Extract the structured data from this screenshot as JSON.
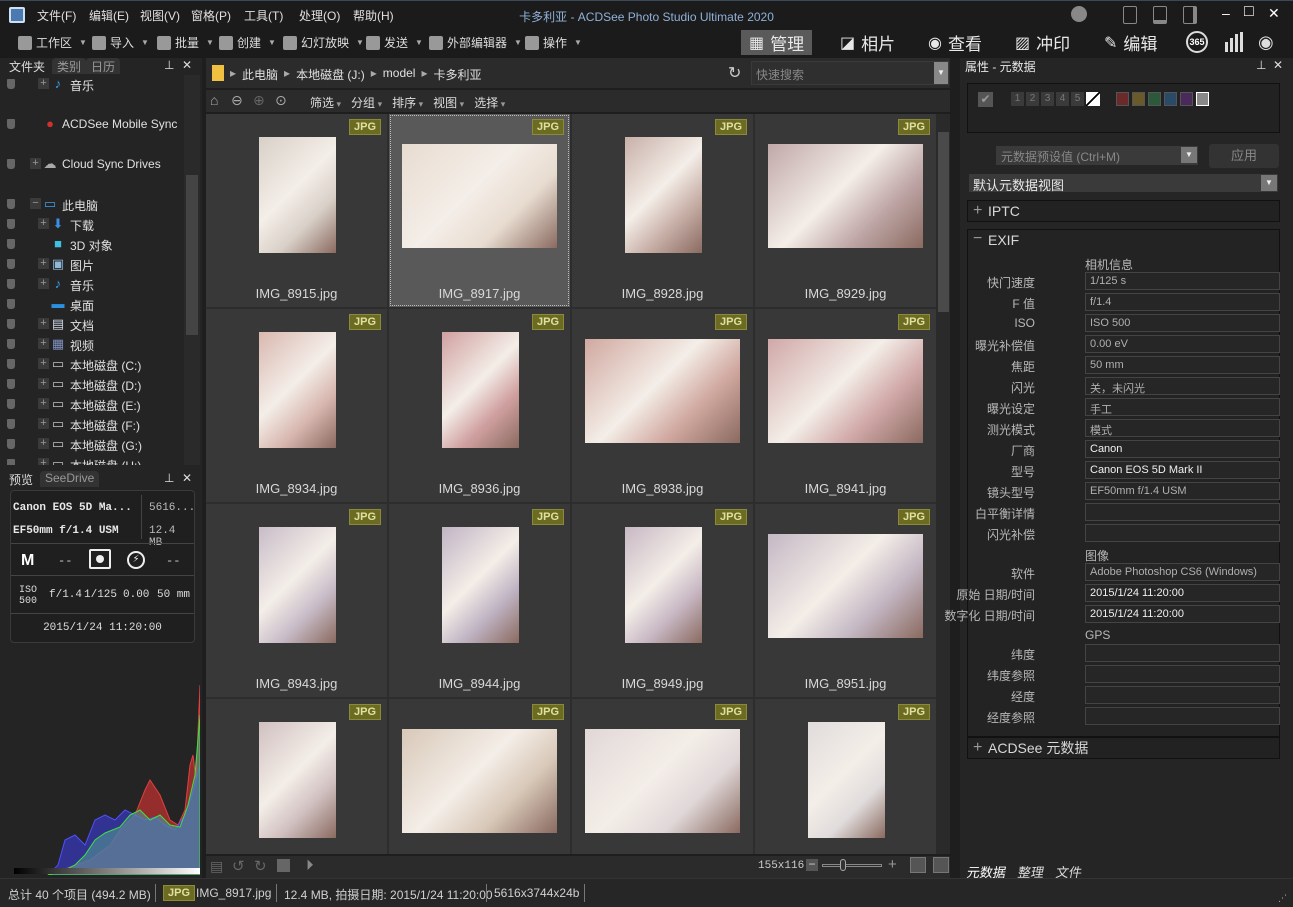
{
  "window": {
    "title": "卡多利亚 - ACDSee Photo Studio Ultimate 2020",
    "controls": {
      "minimize": "‒",
      "maximize": "□",
      "close": "✕"
    }
  },
  "menu": [
    "文件(F)",
    "编辑(E)",
    "视图(V)",
    "窗格(P)",
    "工具(T)",
    "处理(O)",
    "帮助(H)"
  ],
  "toolbar": {
    "items": [
      {
        "label": "工作区",
        "icon": "workspace-icon"
      },
      {
        "label": "导入",
        "icon": "import-icon"
      },
      {
        "label": "批量",
        "icon": "batch-icon"
      },
      {
        "label": "创建",
        "icon": "create-icon"
      },
      {
        "label": "幻灯放映",
        "icon": "slideshow-icon"
      },
      {
        "label": "发送",
        "icon": "send-icon"
      },
      {
        "label": "外部编辑器",
        "icon": "external-editor-icon"
      },
      {
        "label": "操作",
        "icon": "actions-icon"
      }
    ]
  },
  "modes": [
    {
      "label": "管理",
      "active": true
    },
    {
      "label": "相片",
      "active": false
    },
    {
      "label": "查看",
      "active": false
    },
    {
      "label": "冲印",
      "active": false
    },
    {
      "label": "编辑",
      "active": false
    }
  ],
  "mode_extra": {
    "label_365": "365"
  },
  "left_panel": {
    "tabs": [
      "文件夹",
      "类别",
      "日历"
    ],
    "tree": [
      {
        "label": "音乐",
        "indent": 2,
        "expander": "+",
        "icon": "♪",
        "color": "#3aa0e8"
      },
      {
        "label": "ACDSee Mobile Sync",
        "indent": 1,
        "expander": "",
        "icon": "●",
        "color": "#d03030"
      },
      {
        "label": "Cloud Sync Drives",
        "indent": 1,
        "expander": "+",
        "icon": "☁",
        "color": "#aaaaaa"
      },
      {
        "label": "此电脑",
        "indent": 1,
        "expander": "−",
        "icon": "▭",
        "color": "#3aa0e8"
      },
      {
        "label": "下载",
        "indent": 2,
        "expander": "+",
        "icon": "⬇",
        "color": "#3a8ee8"
      },
      {
        "label": "3D 对象",
        "indent": 2,
        "expander": "",
        "icon": "■",
        "color": "#40c0e0"
      },
      {
        "label": "图片",
        "indent": 2,
        "expander": "+",
        "icon": "▣",
        "color": "#90b8d8"
      },
      {
        "label": "音乐",
        "indent": 2,
        "expander": "+",
        "icon": "♪",
        "color": "#3aa0e8"
      },
      {
        "label": "桌面",
        "indent": 2,
        "expander": "",
        "icon": "▬",
        "color": "#2a90e0"
      },
      {
        "label": "文档",
        "indent": 2,
        "expander": "+",
        "icon": "▤",
        "color": "#d0d8e8"
      },
      {
        "label": "视频",
        "indent": 2,
        "expander": "+",
        "icon": "▦",
        "color": "#8090c0"
      },
      {
        "label": "本地磁盘 (C:)",
        "indent": 2,
        "expander": "+",
        "icon": "▭",
        "color": "#c0c0c0"
      },
      {
        "label": "本地磁盘 (D:)",
        "indent": 2,
        "expander": "+",
        "icon": "▭",
        "color": "#c0c0c0"
      },
      {
        "label": "本地磁盘 (E:)",
        "indent": 2,
        "expander": "+",
        "icon": "▭",
        "color": "#c0c0c0"
      },
      {
        "label": "本地磁盘 (F:)",
        "indent": 2,
        "expander": "+",
        "icon": "▭",
        "color": "#c0c0c0"
      },
      {
        "label": "本地磁盘 (G:)",
        "indent": 2,
        "expander": "+",
        "icon": "▭",
        "color": "#c0c0c0"
      },
      {
        "label": "本地磁盘 (H:)",
        "indent": 2,
        "expander": "+",
        "icon": "▭",
        "color": "#c0c0c0"
      }
    ],
    "preview_tabs": [
      "预览",
      "SeeDrive"
    ],
    "preview": {
      "camera": "Canon EOS 5D Ma...",
      "dimensions": "5616...",
      "lens": "EF50mm f/1.4 USM",
      "size": "12.4 MB",
      "mode": "M",
      "wb": "--",
      "flash_extra": "--",
      "iso_label": "ISO",
      "iso": "500",
      "aperture": "f/1.4",
      "shutter": "1/125",
      "ev": "0.00",
      "focal": "50 mm",
      "datetime": "2015/1/24 11:20:00"
    }
  },
  "address": {
    "crumbs": [
      "此电脑",
      "本地磁盘 (J:)",
      "model",
      "卡多利亚"
    ],
    "search_placeholder": "快速搜索"
  },
  "nav_menu": [
    "筛选",
    "分组",
    "排序",
    "视图",
    "选择"
  ],
  "files": [
    {
      "name": "IMG_8915.jpg",
      "type": "JPG",
      "orient": "portrait",
      "selected": false,
      "tone": "#d8d0c8"
    },
    {
      "name": "IMG_8917.jpg",
      "type": "JPG",
      "orient": "landscape",
      "selected": true,
      "tone": "#e8dcd0"
    },
    {
      "name": "IMG_8928.jpg",
      "type": "JPG",
      "orient": "portrait",
      "selected": false,
      "tone": "#c8b0a8"
    },
    {
      "name": "IMG_8929.jpg",
      "type": "JPG",
      "orient": "landscape",
      "selected": false,
      "tone": "#c0a8a8"
    },
    {
      "name": "IMG_8934.jpg",
      "type": "JPG",
      "orient": "portrait",
      "selected": false,
      "tone": "#d8b8b0"
    },
    {
      "name": "IMG_8936.jpg",
      "type": "JPG",
      "orient": "portrait",
      "selected": false,
      "tone": "#d0a0a0"
    },
    {
      "name": "IMG_8938.jpg",
      "type": "JPG",
      "orient": "landscape",
      "selected": false,
      "tone": "#d0a8a0"
    },
    {
      "name": "IMG_8941.jpg",
      "type": "JPG",
      "orient": "landscape",
      "selected": false,
      "tone": "#d0a8a8"
    },
    {
      "name": "IMG_8943.jpg",
      "type": "JPG",
      "orient": "portrait",
      "selected": false,
      "tone": "#c8bcc8"
    },
    {
      "name": "IMG_8944.jpg",
      "type": "JPG",
      "orient": "portrait",
      "selected": false,
      "tone": "#c0b4c4"
    },
    {
      "name": "IMG_8949.jpg",
      "type": "JPG",
      "orient": "portrait",
      "selected": false,
      "tone": "#c8b8c4"
    },
    {
      "name": "IMG_8951.jpg",
      "type": "JPG",
      "orient": "landscape",
      "selected": false,
      "tone": "#c4b8c4"
    },
    {
      "name": "",
      "type": "JPG",
      "orient": "portrait",
      "selected": false,
      "tone": "#d0c0c0"
    },
    {
      "name": "",
      "type": "JPG",
      "orient": "landscape",
      "selected": false,
      "tone": "#d8c8b8"
    },
    {
      "name": "",
      "type": "JPG",
      "orient": "landscape",
      "selected": false,
      "tone": "#e0d8d8"
    },
    {
      "name": "",
      "type": "JPG",
      "orient": "portrait",
      "selected": false,
      "tone": "#e0dcdc"
    }
  ],
  "bottom_bar": {
    "thumb_size": "155x116",
    "zoom_level": 0.35
  },
  "right_panel": {
    "title": "属性 - 元数据",
    "rating_numbers": [
      "1",
      "2",
      "3",
      "4",
      "5"
    ],
    "color_labels": [
      "#6a2a2a",
      "#6a5a2a",
      "#2a5a3a",
      "#2a4a6a",
      "#4a2a5a",
      "#888888"
    ],
    "preset_placeholder": "元数据预设值 (Ctrl+M)",
    "apply_label": "应用",
    "view_select": "默认元数据视图",
    "sections": {
      "iptc": "IPTC",
      "exif": "EXIF",
      "acdsee": "ACDSee 元数据"
    },
    "exif_groups": {
      "camera": "相机信息",
      "image": "图像",
      "gps": "GPS"
    },
    "exif_camera": [
      {
        "label": "快门速度",
        "value": "1/125 s",
        "bright": false
      },
      {
        "label": "F 值",
        "value": "f/1.4",
        "bright": false
      },
      {
        "label": "ISO",
        "value": "ISO 500",
        "bright": false
      },
      {
        "label": "曝光补偿值",
        "value": "0.00 eV",
        "bright": false
      },
      {
        "label": "焦距",
        "value": "50 mm",
        "bright": false
      },
      {
        "label": "闪光",
        "value": "关，未闪光",
        "bright": false
      },
      {
        "label": "曝光设定",
        "value": "手工",
        "bright": false
      },
      {
        "label": "测光模式",
        "value": "模式",
        "bright": false
      },
      {
        "label": "厂商",
        "value": "Canon",
        "bright": true
      },
      {
        "label": "型号",
        "value": "Canon EOS 5D Mark II",
        "bright": true
      },
      {
        "label": "镜头型号",
        "value": "EF50mm f/1.4 USM",
        "bright": false
      },
      {
        "label": "白平衡详情",
        "value": "",
        "bright": false
      },
      {
        "label": "闪光补偿",
        "value": "",
        "bright": false
      }
    ],
    "exif_image": [
      {
        "label": "软件",
        "value": "Adobe Photoshop CS6 (Windows)",
        "bright": false
      },
      {
        "label": "原始 日期/时间",
        "value": "2015/1/24 11:20:00",
        "bright": true
      },
      {
        "label": "数字化 日期/时间",
        "value": "2015/1/24 11:20:00",
        "bright": true
      }
    ],
    "exif_gps": [
      {
        "label": "纬度",
        "value": ""
      },
      {
        "label": "纬度参照",
        "value": ""
      },
      {
        "label": "经度",
        "value": ""
      },
      {
        "label": "经度参照",
        "value": ""
      }
    ],
    "bottom_tabs": [
      "元数据",
      "整理",
      "文件"
    ]
  },
  "status": {
    "total": "总计 40 个项目  (494.2 MB)",
    "type_badge": "JPG",
    "filename": "IMG_8917.jpg",
    "info": "12.4 MB, 拍摄日期: 2015/1/24 11:20:00",
    "dims": "5616x3744x24b"
  }
}
